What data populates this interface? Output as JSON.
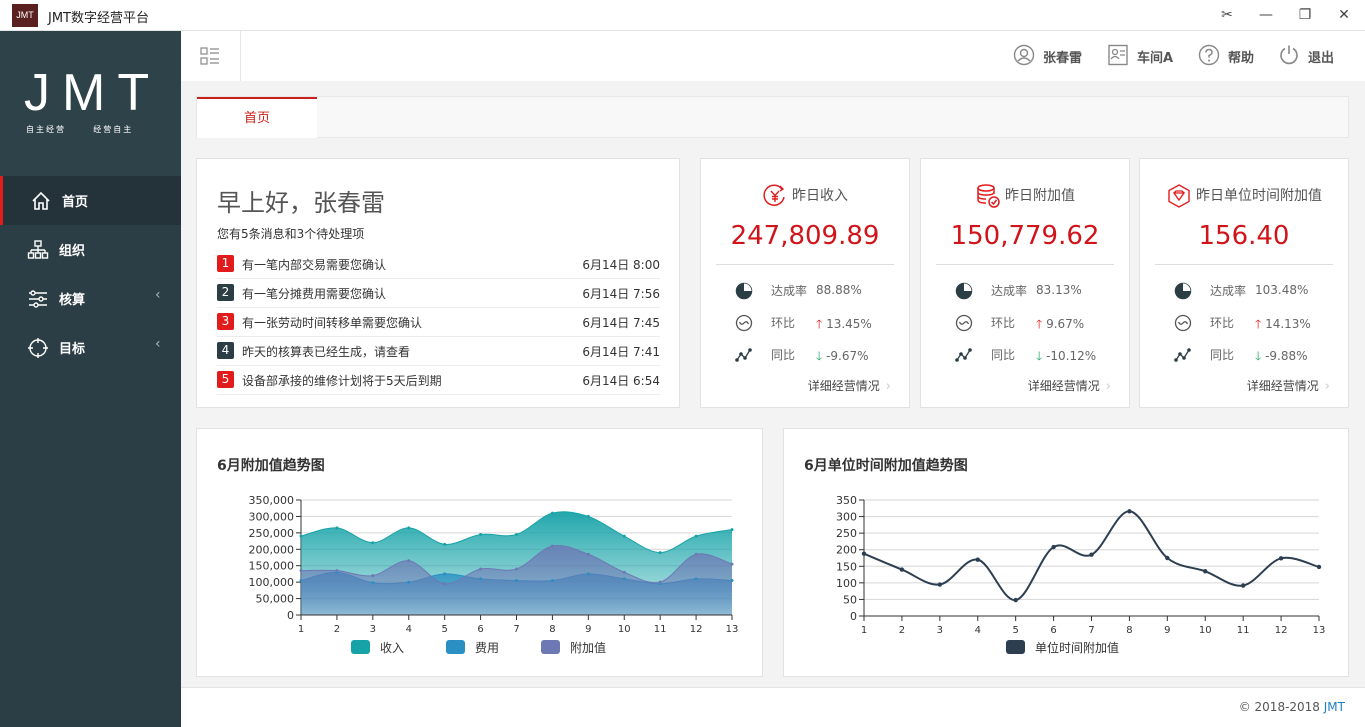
{
  "window": {
    "logo": "JMT",
    "title": "JMT数字经营平台",
    "buttons": [
      "✂",
      "—",
      "❐",
      "✕"
    ]
  },
  "brand": {
    "main": "JMT",
    "tagline": "自主经营      经营自主"
  },
  "sidebar": {
    "items": [
      {
        "label": "首页",
        "icon": "home-icon",
        "active": true,
        "arrow": ""
      },
      {
        "label": "组织",
        "icon": "org-icon",
        "active": false,
        "arrow": ""
      },
      {
        "label": "核算",
        "icon": "list-icon",
        "active": false,
        "arrow": "‹"
      },
      {
        "label": "目标",
        "icon": "target-icon",
        "active": false,
        "arrow": "‹"
      }
    ]
  },
  "topbar": {
    "user": "张春雷",
    "workshop": "车间A",
    "help": "帮助",
    "logout": "退出"
  },
  "tabs": [
    {
      "label": "首页"
    }
  ],
  "welcome": {
    "greeting": "早上好，张春雷",
    "summary": "您有5条消息和3个待处理项",
    "tasks": [
      {
        "num": "1",
        "text": "有一笔内部交易需要您确认",
        "time": "6月14日 8:00",
        "color": "#e21c1c"
      },
      {
        "num": "2",
        "text": "有一笔分摊费用需要您确认",
        "time": "6月14日 7:56",
        "color": "#2c3e45"
      },
      {
        "num": "3",
        "text": "有一张劳动时间转移单需要您确认",
        "time": "6月14日 7:45",
        "color": "#e21c1c"
      },
      {
        "num": "4",
        "text": "昨天的核算表已经生成，请查看",
        "time": "6月14日 7:41",
        "color": "#2c3e45"
      },
      {
        "num": "5",
        "text": "设备部承接的维修计划将于5天后到期",
        "time": "6月14日 6:54",
        "color": "#e21c1c"
      }
    ]
  },
  "kpis": [
    {
      "title": "昨日收入",
      "icon": "yuan-icon",
      "value": "247,809.89",
      "rate_label": "达成率",
      "rate": "88.88%",
      "mom_label": "环比",
      "mom": "13.45%",
      "yoy_label": "同比",
      "yoy": "-9.67%",
      "more": "详细经营情况"
    },
    {
      "title": "昨日附加值",
      "icon": "database-icon",
      "value": "150,779.62",
      "rate_label": "达成率",
      "rate": "83.13%",
      "mom_label": "环比",
      "mom": "9.67%",
      "yoy_label": "同比",
      "yoy": "-10.12%",
      "more": "详细经营情况"
    },
    {
      "title": "昨日单位时间附加值",
      "icon": "gem-icon",
      "value": "156.40",
      "rate_label": "达成率",
      "rate": "103.48%",
      "mom_label": "环比",
      "mom": "14.13%",
      "yoy_label": "同比",
      "yoy": "-9.88%",
      "more": "详细经营情况"
    }
  ],
  "chart_data": [
    {
      "type": "area",
      "title": "6月附加值趋势图",
      "x": [
        1,
        2,
        3,
        4,
        5,
        6,
        7,
        8,
        9,
        10,
        11,
        12,
        13
      ],
      "ylim": [
        0,
        350000
      ],
      "yticks": [
        "0",
        "50,000",
        "100,000",
        "150,000",
        "200,000",
        "250,000",
        "300,000",
        "350,000"
      ],
      "grid": true,
      "legend": "bottom",
      "series": [
        {
          "name": "收入",
          "color": "#16a3a8",
          "values": [
            240000,
            265000,
            220000,
            265000,
            215000,
            245000,
            245000,
            310000,
            300000,
            240000,
            190000,
            240000,
            260000
          ]
        },
        {
          "name": "费用",
          "color": "#2a8fc2",
          "values": [
            105000,
            130000,
            98000,
            100000,
            125000,
            110000,
            105000,
            105000,
            125000,
            110000,
            95000,
            110000,
            105000
          ]
        },
        {
          "name": "附加值",
          "color": "#6d79b5",
          "values": [
            135000,
            135000,
            120000,
            165000,
            95000,
            140000,
            140000,
            210000,
            185000,
            130000,
            100000,
            185000,
            155000
          ]
        }
      ]
    },
    {
      "type": "line",
      "title": "6月单位时间附加值趋势图",
      "x": [
        1,
        2,
        3,
        4,
        5,
        6,
        7,
        8,
        9,
        10,
        11,
        12,
        13
      ],
      "ylim": [
        0,
        350
      ],
      "yticks": [
        "0",
        "50",
        "100",
        "150",
        "200",
        "250",
        "300",
        "350"
      ],
      "grid": true,
      "legend": "bottom",
      "series": [
        {
          "name": "单位时间附加值",
          "color": "#2c3e50",
          "values": [
            188,
            140,
            95,
            170,
            48,
            208,
            185,
            316,
            175,
            135,
            92,
            174,
            148
          ]
        }
      ]
    }
  ],
  "footer": {
    "copyright": "© 2018-2018 ",
    "brand": "JMT"
  }
}
